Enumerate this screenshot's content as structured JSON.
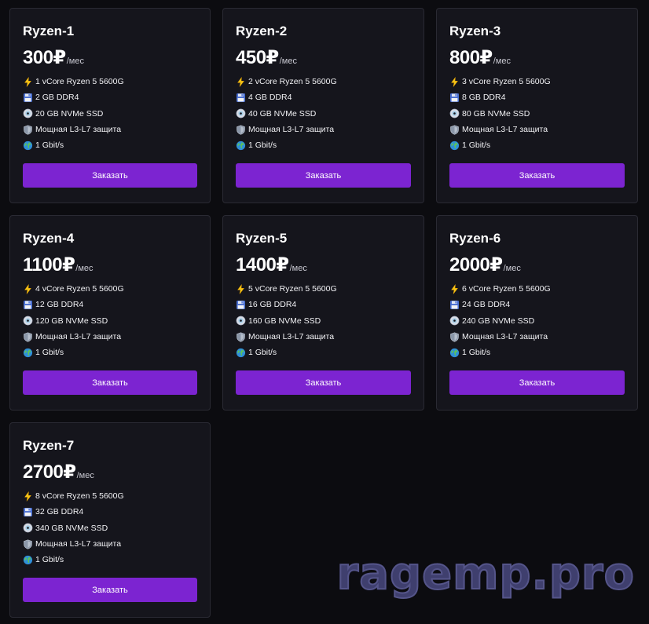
{
  "plans": [
    {
      "title": "Ryzen-1",
      "price": "300₽",
      "per": "/мес",
      "features": [
        "1 vCore Ryzen 5 5600G",
        "2 GB DDR4",
        "20 GB NVMe SSD",
        "Мощная L3-L7 защита",
        "1 Gbit/s"
      ],
      "button": "Заказать"
    },
    {
      "title": "Ryzen-2",
      "price": "450₽",
      "per": "/мес",
      "features": [
        "2 vCore Ryzen 5 5600G",
        "4 GB DDR4",
        "40 GB NVMe SSD",
        "Мощная L3-L7 защита",
        "1 Gbit/s"
      ],
      "button": "Заказать"
    },
    {
      "title": "Ryzen-3",
      "price": "800₽",
      "per": "/мес",
      "features": [
        "3 vCore Ryzen 5 5600G",
        "8 GB DDR4",
        "80 GB NVMe SSD",
        "Мощная L3-L7 защита",
        "1 Gbit/s"
      ],
      "button": "Заказать"
    },
    {
      "title": "Ryzen-4",
      "price": "1100₽",
      "per": "/мес",
      "features": [
        "4 vCore Ryzen 5 5600G",
        "12 GB DDR4",
        "120 GB NVMe SSD",
        "Мощная L3-L7 защита",
        "1 Gbit/s"
      ],
      "button": "Заказать"
    },
    {
      "title": "Ryzen-5",
      "price": "1400₽",
      "per": "/мес",
      "features": [
        "5 vCore Ryzen 5 5600G",
        "16 GB DDR4",
        "160 GB NVMe SSD",
        "Мощная L3-L7 защита",
        "1 Gbit/s"
      ],
      "button": "Заказать"
    },
    {
      "title": "Ryzen-6",
      "price": "2000₽",
      "per": "/мес",
      "features": [
        "6 vCore Ryzen 5 5600G",
        "24 GB DDR4",
        "240 GB NVMe SSD",
        "Мощная L3-L7 защита",
        "1 Gbit/s"
      ],
      "button": "Заказать"
    },
    {
      "title": "Ryzen-7",
      "price": "2700₽",
      "per": "/мес",
      "features": [
        "8 vCore Ryzen 5 5600G",
        "32 GB DDR4",
        "340 GB NVMe SSD",
        "Мощная L3-L7 защита",
        "1 Gbit/s"
      ],
      "button": "Заказать"
    }
  ],
  "feature_icons": [
    "lightning-icon",
    "floppy-disk-icon",
    "disc-icon",
    "shield-icon",
    "globe-icon"
  ],
  "colors": {
    "background": "#0c0c10",
    "card": "#15151c",
    "card_border": "#2a2a33",
    "button": "#7c24d1",
    "watermark": "#3f3f6e"
  },
  "watermark": "ragemp.pro"
}
